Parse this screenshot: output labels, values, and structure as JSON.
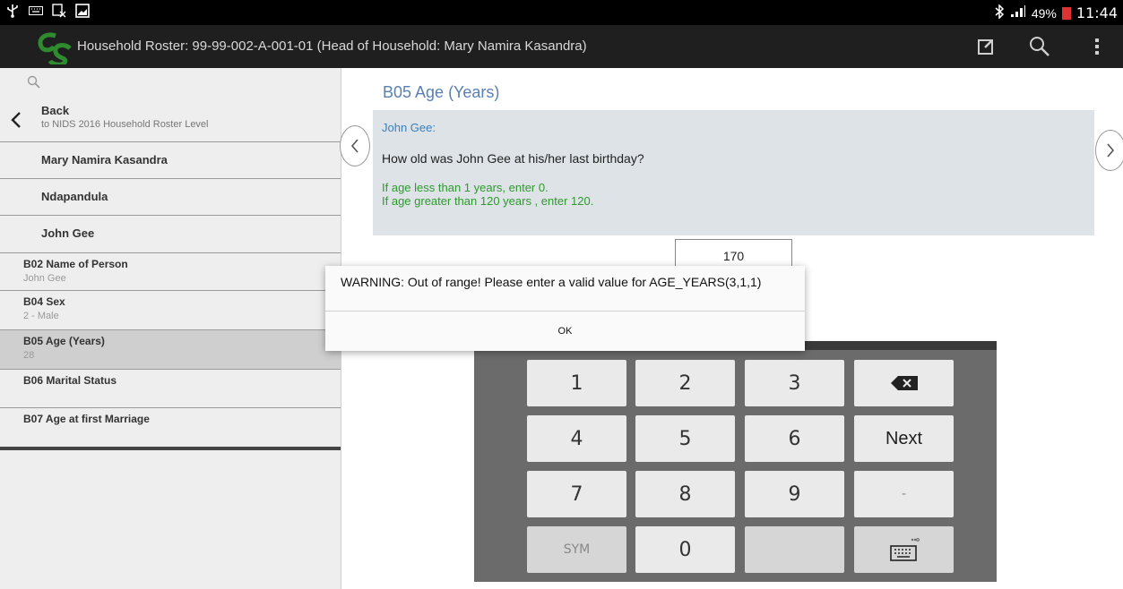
{
  "status_bar": {
    "battery": "49%",
    "time": "11:44",
    "icons": [
      "usb-icon",
      "keyboard-icon",
      "notification-icon",
      "image-icon",
      "bluetooth-icon",
      "signal-icon",
      "battery-icon"
    ]
  },
  "action_bar": {
    "title": "Household Roster: 99-99-002-A-001-01 (Head of Household: Mary Namira Kasandra)",
    "icons": [
      "app-logo",
      "edit-icon",
      "search-icon",
      "overflow-menu-icon"
    ]
  },
  "sidebar": {
    "back": {
      "title": "Back",
      "subtitle": "to NIDS 2016 Household Roster Level"
    },
    "members": [
      "Mary Namira Kasandra",
      "Ndapandula",
      "John Gee"
    ],
    "fields": [
      {
        "name": "B02 Name of Person",
        "value": "John Gee"
      },
      {
        "name": "B04 Sex",
        "value": "2 - Male"
      },
      {
        "name": "B05 Age (Years)",
        "value": "28",
        "selected": true
      },
      {
        "name": "B06 Marital Status",
        "value": ""
      },
      {
        "name": "B07 Age at first Marriage",
        "value": ""
      }
    ]
  },
  "question": {
    "heading": "B05 Age (Years)",
    "person": "John Gee:",
    "text": "How old was John Gee at his/her last birthday?",
    "note_line1": "If age less than 1 years, enter 0.",
    "note_line2": "If age greater than 120 years , enter 120.",
    "answer": "170"
  },
  "keypad": {
    "keys": [
      "1",
      "2",
      "3",
      "4",
      "5",
      "6",
      "Next",
      "7",
      "8",
      "9",
      "-",
      "SYM",
      "0"
    ]
  },
  "dialog": {
    "message": "WARNING: Out of range! Please enter a valid value for AGE_YEARS(3,1,1)",
    "ok_label": "OK"
  },
  "colors": {
    "heading": "#5a7fb0",
    "note_green": "#2e9a2e",
    "logo_green": "#2e8b2e"
  }
}
